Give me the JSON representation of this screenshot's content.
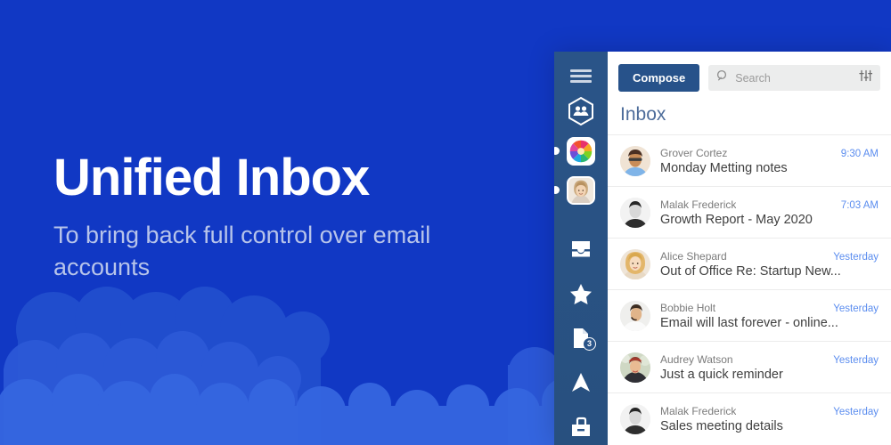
{
  "hero": {
    "title": "Unified Inbox",
    "subtitle": "To bring back full control over email accounts"
  },
  "colors": {
    "background": "#1138c4",
    "cloud": "#2a55cc",
    "rail": "#2a5488",
    "compose": "#27528a",
    "section_title": "#4d6c9a",
    "time": "#5b8def"
  },
  "app": {
    "rail": {
      "menu_icon": "hamburger-icon",
      "unified_icon": "hexagon-people-icon",
      "accounts": [
        {
          "name": "account-rainbow",
          "badge_dot": true
        },
        {
          "name": "account-portrait",
          "badge_dot": true
        }
      ],
      "nav": [
        {
          "icon": "inbox-tray-icon",
          "label": "Inbox",
          "badge": ""
        },
        {
          "icon": "star-icon",
          "label": "Starred",
          "badge": ""
        },
        {
          "icon": "drafts-page-icon",
          "label": "Drafts",
          "badge": "3"
        },
        {
          "icon": "send-plane-icon",
          "label": "Sent",
          "badge": ""
        },
        {
          "icon": "archive-box-icon",
          "label": "Archive",
          "badge": ""
        }
      ]
    },
    "toolbar": {
      "compose_label": "Compose",
      "search_placeholder": "Search",
      "search_value": "",
      "search_icon": "search-icon",
      "filter_icon": "filter-sliders-icon"
    },
    "section_title": "Inbox",
    "emails": [
      {
        "from": "Grover Cortez",
        "subject": "Monday Metting notes",
        "time": "9:30 AM",
        "avatar": "grover-cortez"
      },
      {
        "from": "Malak Frederick",
        "subject": "Growth Report - May 2020",
        "time": "7:03 AM",
        "avatar": "malak-frederick"
      },
      {
        "from": "Alice Shepard",
        "subject": "Out of Office Re: Startup New...",
        "time": "Yesterday",
        "avatar": "alice-shepard"
      },
      {
        "from": "Bobbie Holt",
        "subject": "Email will last forever - online...",
        "time": "Yesterday",
        "avatar": "bobbie-holt"
      },
      {
        "from": "Audrey Watson",
        "subject": "Just a quick reminder",
        "time": "Yesterday",
        "avatar": "audrey-watson"
      },
      {
        "from": "Malak Frederick",
        "subject": "Sales meeting details",
        "time": "Yesterday",
        "avatar": "malak-frederick-2"
      }
    ]
  }
}
